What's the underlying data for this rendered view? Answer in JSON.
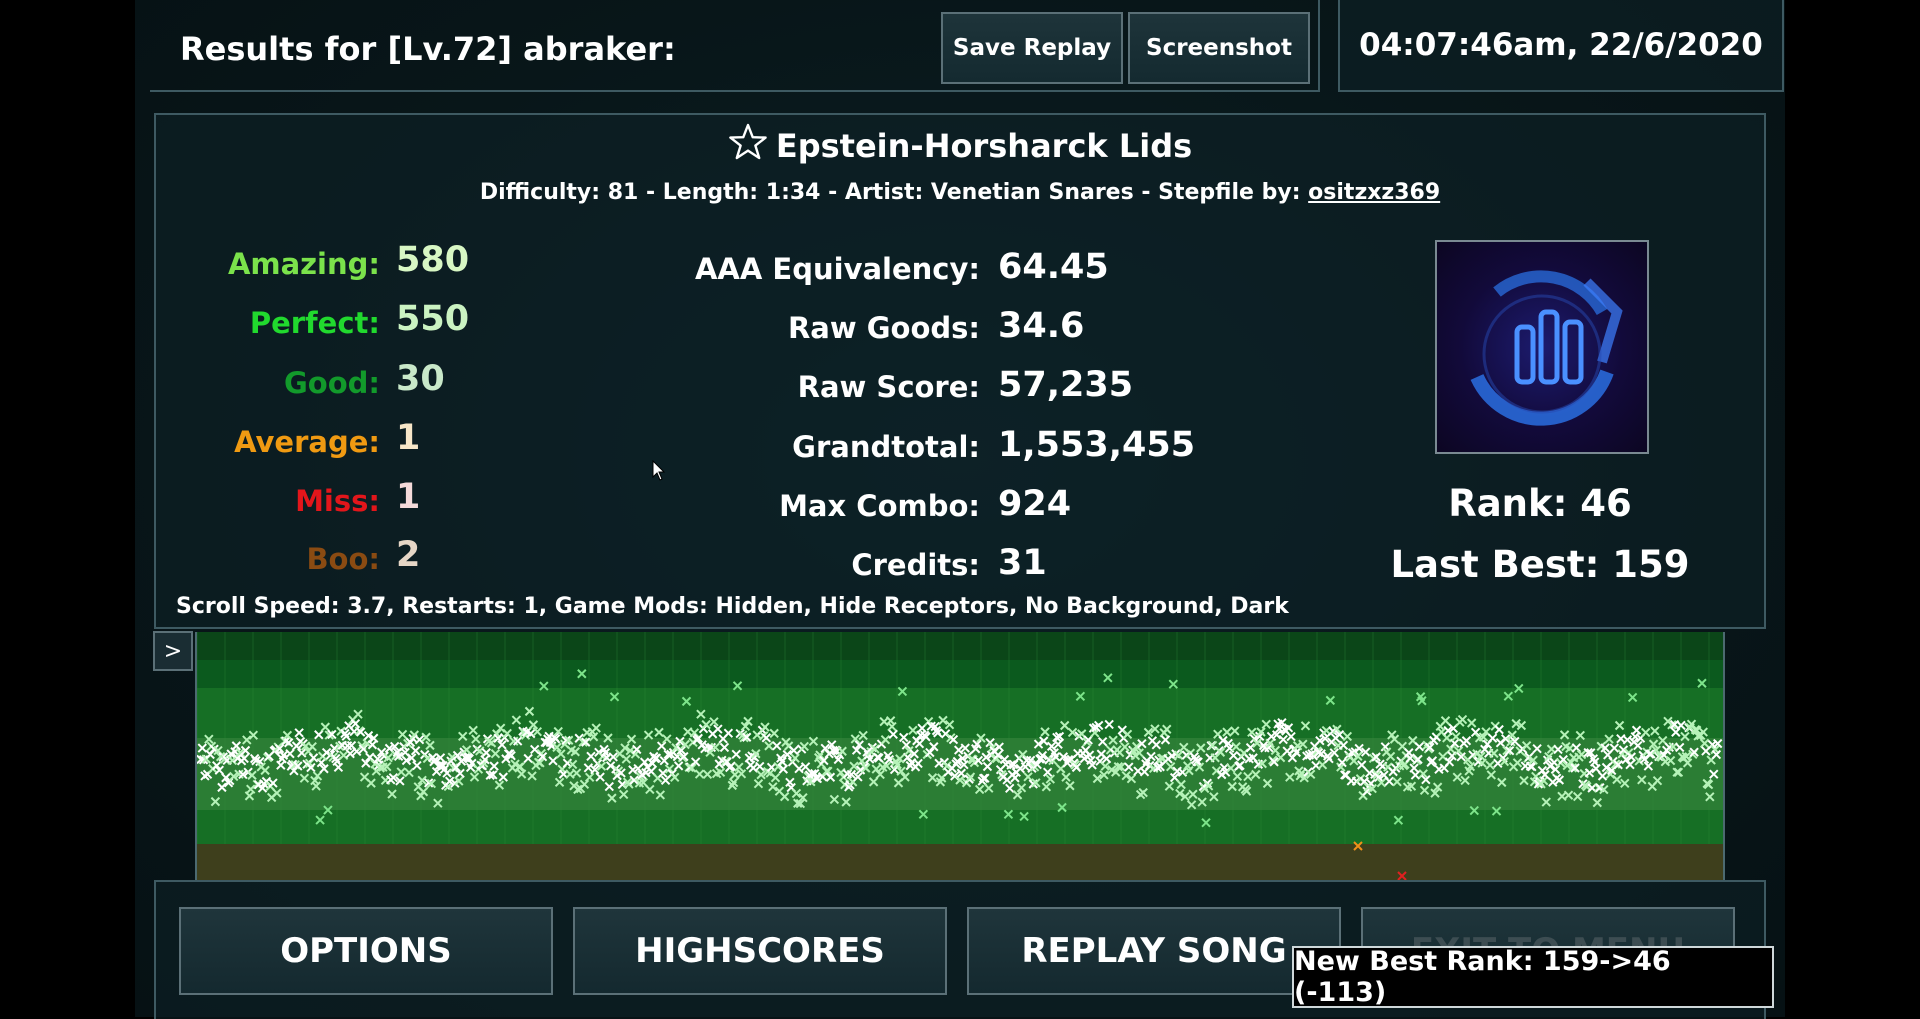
{
  "header": {
    "results_title": "Results for [Lv.72] abraker:",
    "save_replay": "Save Replay",
    "screenshot": "Screenshot",
    "datetime": "04:07:46am, 22/6/2020"
  },
  "song": {
    "title": "Epstein-Horsharck Lids",
    "info_prefix": "Difficulty: 81 - Length: 1:34 - Artist: Venetian Snares - Stepfile by:",
    "stepfile_author": "ositzxz369"
  },
  "judgements": [
    {
      "label": "Amazing:",
      "value": "580",
      "color": "#7be24b",
      "value_color": "#d8f7c4"
    },
    {
      "label": "Perfect:",
      "value": "550",
      "color": "#21d92e",
      "value_color": "#cbf3c2"
    },
    {
      "label": "Good:",
      "value": "30",
      "color": "#129a2b",
      "value_color": "#c9e8c9"
    },
    {
      "label": "Average:",
      "value": "1",
      "color": "#f09a12",
      "value_color": "#f7e6c8"
    },
    {
      "label": "Miss:",
      "value": "1",
      "color": "#e3161b",
      "value_color": "#f5dada"
    },
    {
      "label": "Boo:",
      "value": "2",
      "color": "#8a4b12",
      "value_color": "#e6d6c6"
    }
  ],
  "stats": [
    {
      "label": "AAA Equivalency:",
      "value": "64.45"
    },
    {
      "label": "Raw Goods:",
      "value": "34.6"
    },
    {
      "label": "Raw Score:",
      "value": "57,235"
    },
    {
      "label": "Grandtotal:",
      "value": "1,553,455"
    },
    {
      "label": "Max Combo:",
      "value": "924"
    },
    {
      "label": "Credits:",
      "value": "31"
    }
  ],
  "rank": {
    "rank_text": "Rank: 46",
    "last_best_text": "Last Best: 159"
  },
  "mods_line": "Scroll Speed: 3.7, Restarts: 1, Game Mods: Hidden, Hide Receptors, No Background, Dark",
  "graph": {
    "toggle_label": ">",
    "colors": {
      "amazing": "#ffffff",
      "perfect": "#b6f2b8",
      "good": "#7de48a",
      "average": "#f0901a",
      "miss": "#e22020"
    }
  },
  "buttons": {
    "options": "OPTIONS",
    "highscores": "HIGHSCORES",
    "replay_song": "REPLAY SONG",
    "exit_to_menu": "EXIT TO MENU"
  },
  "toast": "New Best Rank: 159->46 (-113)"
}
